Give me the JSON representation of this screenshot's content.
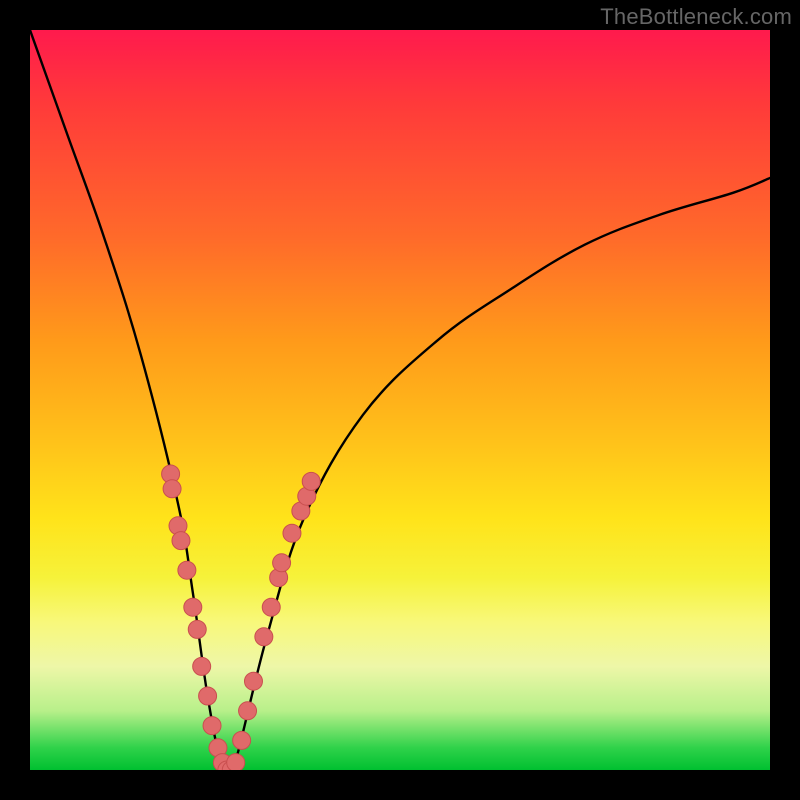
{
  "watermark": {
    "text": "TheBottleneck.com"
  },
  "chart_data": {
    "type": "line",
    "title": "",
    "xlabel": "",
    "ylabel": "",
    "xlim": [
      0,
      100
    ],
    "ylim": [
      0,
      100
    ],
    "x": [
      0,
      5,
      10,
      15,
      20,
      22,
      24,
      26,
      27,
      28,
      32,
      37,
      45,
      55,
      65,
      75,
      85,
      95,
      100
    ],
    "values": [
      100,
      86,
      72,
      56,
      36,
      24,
      10,
      0,
      0,
      2,
      18,
      34,
      48,
      58,
      65,
      71,
      75,
      78,
      80
    ],
    "series": [
      {
        "name": "bottleneck-curve",
        "x": [
          0,
          5,
          10,
          15,
          20,
          22,
          24,
          26,
          27,
          28,
          32,
          37,
          45,
          55,
          65,
          75,
          85,
          95,
          100
        ],
        "values": [
          100,
          86,
          72,
          56,
          36,
          24,
          10,
          0,
          0,
          2,
          18,
          34,
          48,
          58,
          65,
          71,
          75,
          78,
          80
        ]
      }
    ],
    "markers": [
      {
        "x": 19.0,
        "y": 40
      },
      {
        "x": 19.2,
        "y": 38
      },
      {
        "x": 20.0,
        "y": 33
      },
      {
        "x": 20.4,
        "y": 31
      },
      {
        "x": 21.2,
        "y": 27
      },
      {
        "x": 22.0,
        "y": 22
      },
      {
        "x": 22.6,
        "y": 19
      },
      {
        "x": 23.2,
        "y": 14
      },
      {
        "x": 24.0,
        "y": 10
      },
      {
        "x": 24.6,
        "y": 6
      },
      {
        "x": 25.4,
        "y": 3
      },
      {
        "x": 26.0,
        "y": 1
      },
      {
        "x": 26.6,
        "y": 0
      },
      {
        "x": 27.2,
        "y": 0
      },
      {
        "x": 27.8,
        "y": 1
      },
      {
        "x": 28.6,
        "y": 4
      },
      {
        "x": 29.4,
        "y": 8
      },
      {
        "x": 30.2,
        "y": 12
      },
      {
        "x": 31.6,
        "y": 18
      },
      {
        "x": 32.6,
        "y": 22
      },
      {
        "x": 33.6,
        "y": 26
      },
      {
        "x": 34.0,
        "y": 28
      },
      {
        "x": 35.4,
        "y": 32
      },
      {
        "x": 36.6,
        "y": 35
      },
      {
        "x": 37.4,
        "y": 37
      },
      {
        "x": 38.0,
        "y": 39
      }
    ],
    "colors": {
      "curve": "#000000",
      "marker_fill": "#e06a6a",
      "marker_stroke": "#c94f4f",
      "gradient_top": "#ff1a4d",
      "gradient_bottom": "#00c030"
    }
  }
}
